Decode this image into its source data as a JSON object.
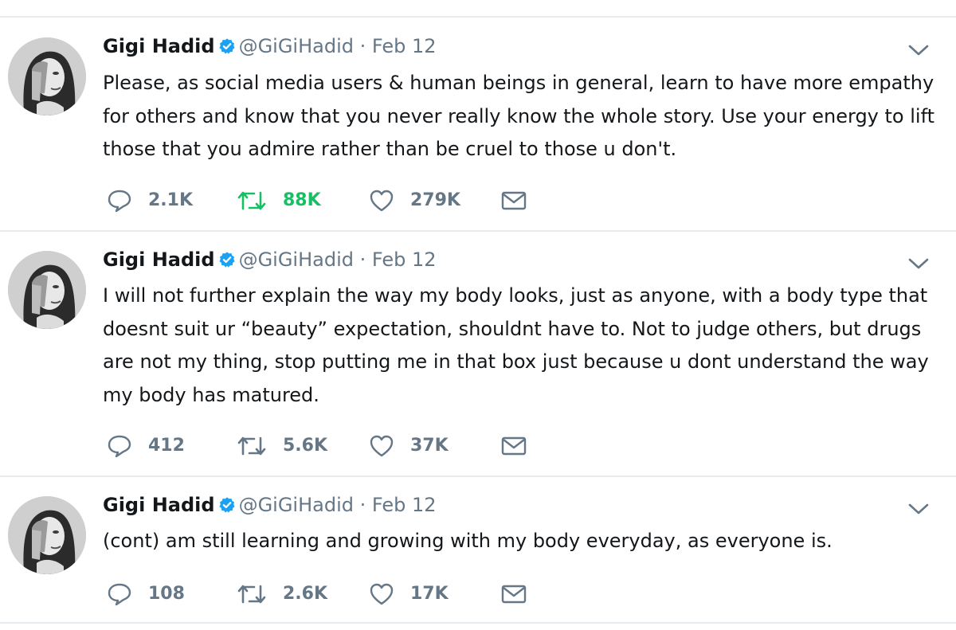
{
  "tweets": [
    {
      "name": "Gigi Hadid",
      "handle": "@GiGiHadid",
      "date": "Feb 12",
      "separator": "·",
      "text": "Please, as social media users & human beings in general, learn to have more empathy for others and know that you never really know the whole story. Use your energy to lift those that you admire rather than be cruel to those u don't.",
      "replies": "2.1K",
      "retweets": "88K",
      "likes": "279K",
      "retweeted": true
    },
    {
      "name": "Gigi Hadid",
      "handle": "@GiGiHadid",
      "date": "Feb 12",
      "separator": "·",
      "text": "I will not further explain the way my body looks, just as anyone, with a  body type that doesnt suit ur “beauty” expectation, shouldnt have to. Not to judge others, but drugs are not my thing, stop putting me in that box just because u dont understand the way my body has matured.",
      "replies": "412",
      "retweets": "5.6K",
      "likes": "37K",
      "retweeted": false
    },
    {
      "name": "Gigi Hadid",
      "handle": "@GiGiHadid",
      "date": "Feb 12",
      "separator": "·",
      "text": "(cont) am still learning and growing with my body everyday, as everyone is.",
      "replies": "108",
      "retweets": "2.6K",
      "likes": "17K",
      "retweeted": false
    }
  ],
  "icons": {
    "reply": "speech-bubble-icon",
    "retweet": "retweet-arrows-icon",
    "like": "heart-outline-icon",
    "dm": "envelope-icon",
    "verified": "verified-badge-icon",
    "caret": "chevron-down-icon"
  },
  "colors": {
    "text": "#14171a",
    "meta": "#657786",
    "verified": "#1da1f2",
    "retweet_active": "#17bf63",
    "divider": "#e6ecf0"
  }
}
